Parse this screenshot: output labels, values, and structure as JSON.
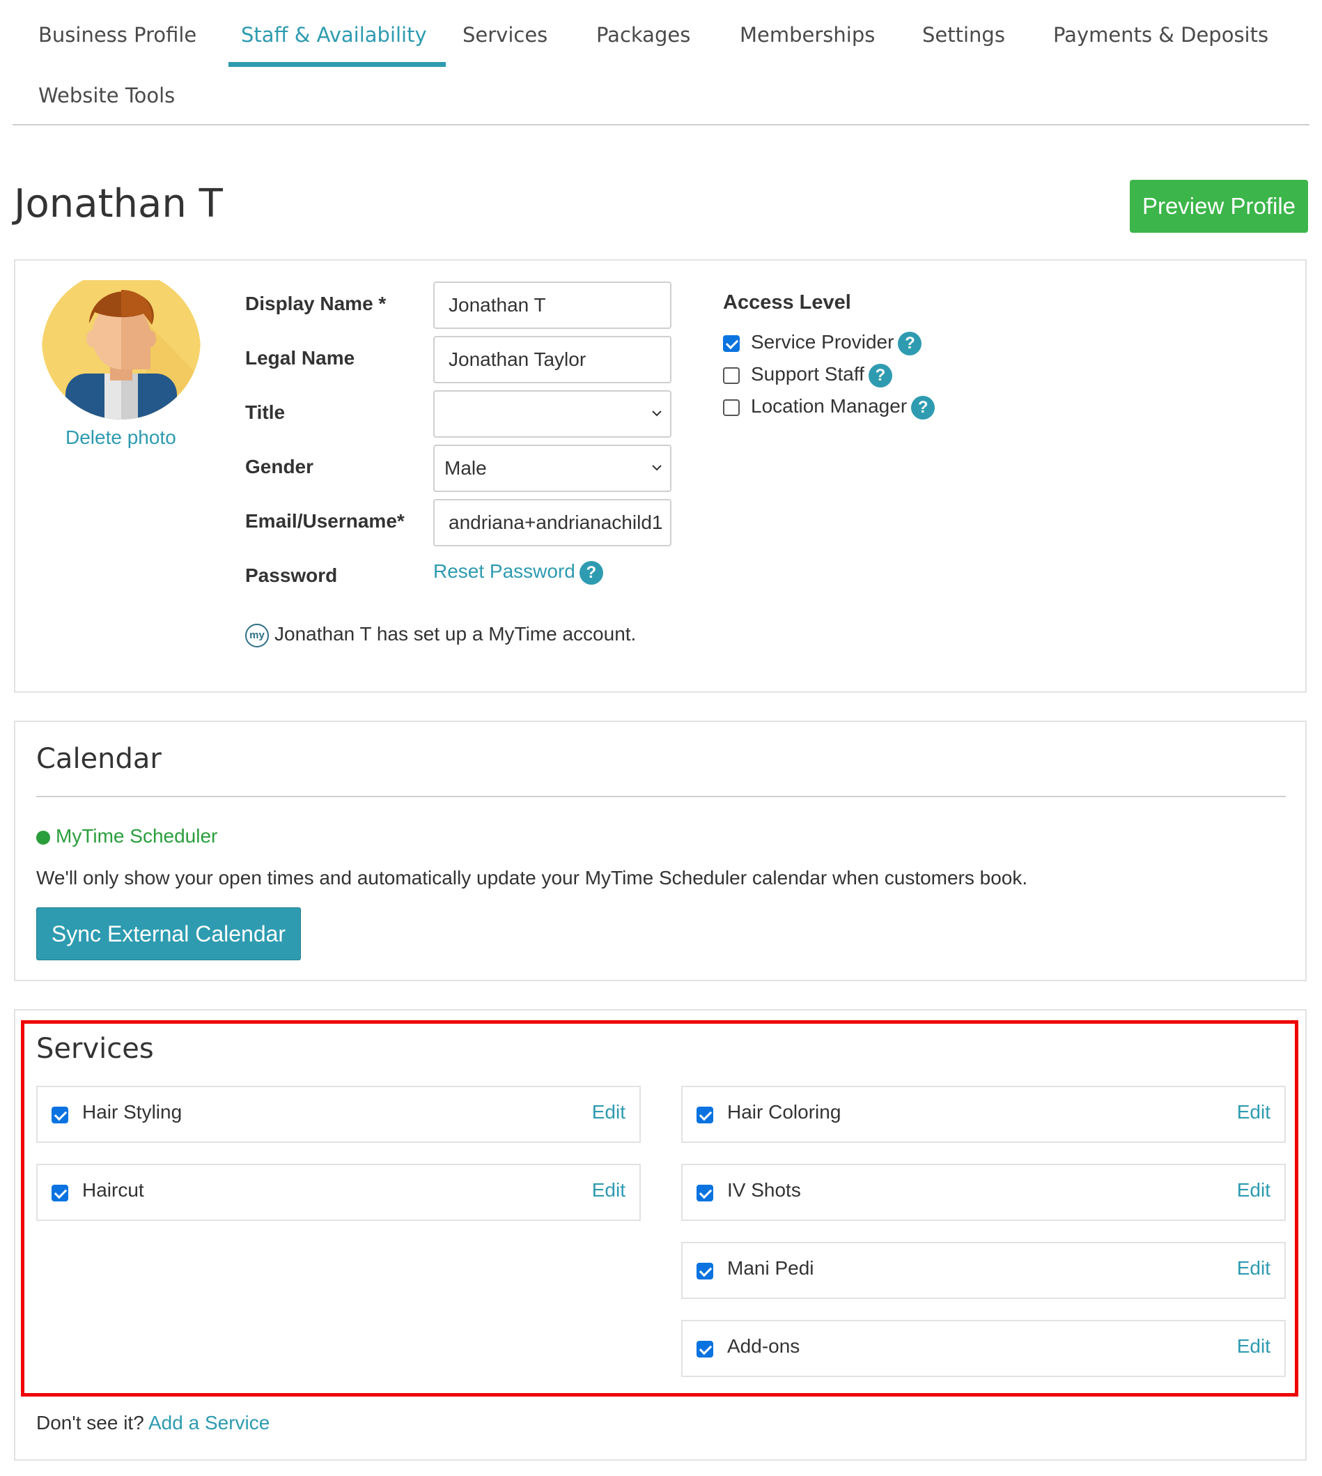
{
  "nav": {
    "tabs": [
      {
        "label": "Business Profile"
      },
      {
        "label": "Staff & Availability"
      },
      {
        "label": "Services"
      },
      {
        "label": "Packages"
      },
      {
        "label": "Memberships"
      },
      {
        "label": "Settings"
      },
      {
        "label": "Payments & Deposits"
      },
      {
        "label": "Website Tools"
      }
    ],
    "active": "Staff & Availability"
  },
  "header": {
    "staff_name": "Jonathan T",
    "preview_button": "Preview Profile"
  },
  "profile": {
    "delete_photo": "Delete photo",
    "fields": {
      "display_name": {
        "label": "Display Name *",
        "value": "Jonathan T"
      },
      "legal_name": {
        "label": "Legal Name",
        "value": "Jonathan Taylor"
      },
      "title": {
        "label": "Title",
        "value": ""
      },
      "gender": {
        "label": "Gender",
        "value": "Male"
      },
      "email": {
        "label": "Email/Username*",
        "value": "andriana+andrianachild1"
      },
      "password": {
        "label": "Password",
        "link": "Reset Password"
      }
    },
    "help_glyph": "?",
    "mytime_logo": "my",
    "mytime_note": "Jonathan T has set up a MyTime account."
  },
  "access": {
    "title": "Access Level",
    "options": [
      {
        "label": "Service Provider",
        "checked": true
      },
      {
        "label": "Support Staff",
        "checked": false
      },
      {
        "label": "Location Manager",
        "checked": false
      }
    ]
  },
  "calendar": {
    "title": "Calendar",
    "scheduler": "MyTime Scheduler",
    "description": "We'll only show your open times and automatically update your MyTime Scheduler calendar when customers book.",
    "sync_button": "Sync External Calendar"
  },
  "services": {
    "title": "Services",
    "edit_label": "Edit",
    "left": [
      {
        "name": "Hair Styling",
        "checked": true
      },
      {
        "name": "Haircut",
        "checked": true
      }
    ],
    "right": [
      {
        "name": "Hair Coloring",
        "checked": true
      },
      {
        "name": "IV Shots",
        "checked": true
      },
      {
        "name": "Mani Pedi",
        "checked": true
      },
      {
        "name": "Add-ons",
        "checked": true
      }
    ],
    "footer_prefix": "Don't see it?",
    "footer_link": "Add a Service"
  },
  "colors": {
    "accent": "#2e9bb0",
    "preview_green": "#3cb54a",
    "checkbox_blue": "#0b73e0",
    "highlight_red": "#ee0000",
    "scheduler_green": "#2a9e3c"
  },
  "icons": {
    "help": "help-icon",
    "caret": "chevron-down-icon",
    "status_dot": "status-dot-icon",
    "mytime": "mytime-logo-icon"
  }
}
